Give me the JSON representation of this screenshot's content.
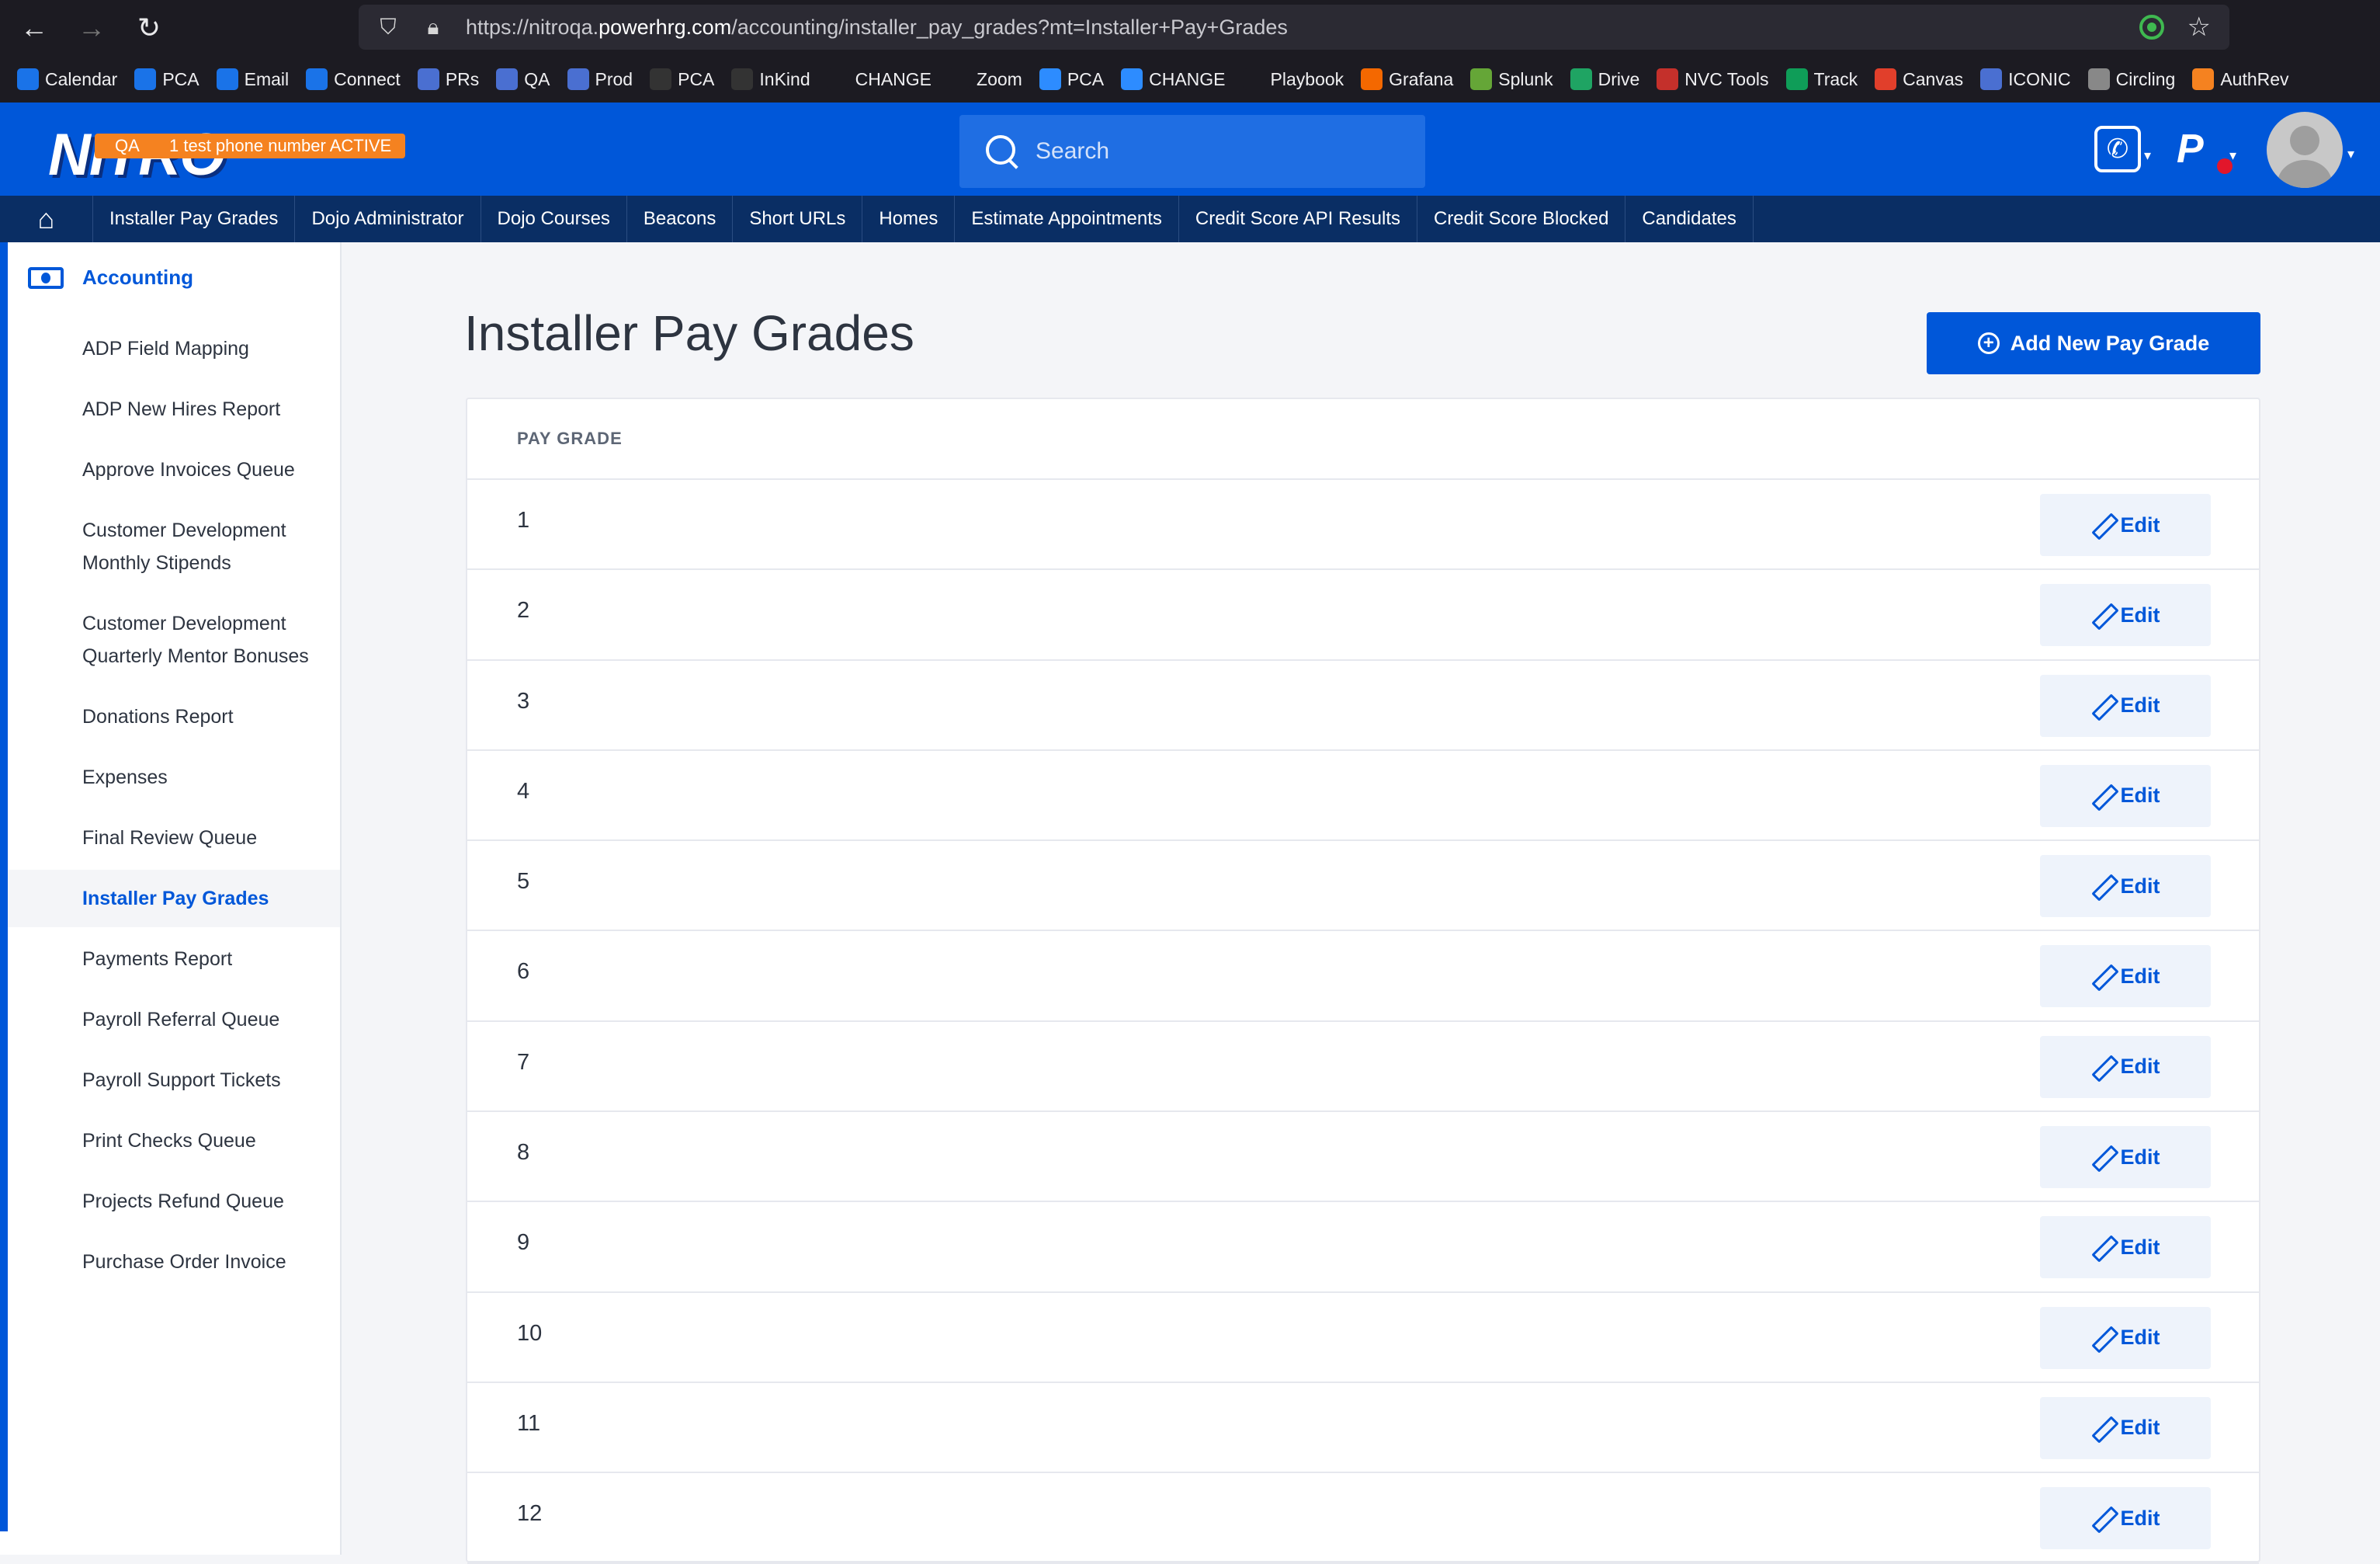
{
  "browser": {
    "url_prefix": "https://nitroqa.",
    "url_domain": "powerhrg.com",
    "url_path": "/accounting/installer_pay_grades?mt=Installer+Pay+Grades"
  },
  "bookmarks": [
    {
      "label": "Calendar",
      "icon": "calendar-icon",
      "color": "#1a73e8"
    },
    {
      "label": "PCA",
      "icon": "pca-icon",
      "color": "#1a73e8"
    },
    {
      "label": "Email",
      "icon": "email-icon",
      "color": "#1a73e8"
    },
    {
      "label": "Connect",
      "icon": "connect-icon",
      "color": "#1a73e8"
    },
    {
      "label": "PRs",
      "icon": "prs-icon",
      "color": "#4a6fd1"
    },
    {
      "label": "QA",
      "icon": "qa-icon",
      "color": "#4a6fd1"
    },
    {
      "label": "Prod",
      "icon": "prod-icon",
      "color": "#4a6fd1"
    },
    {
      "label": "PCA",
      "icon": "github-icon",
      "color": "#333333"
    },
    {
      "label": "InKind",
      "icon": "github-icon",
      "color": "#333333"
    },
    {
      "label": "CHANGE",
      "icon": "folder-icon",
      "color": "#1c1b22"
    },
    {
      "label": "Zoom",
      "icon": "folder-icon",
      "color": "#1c1b22"
    },
    {
      "label": "PCA",
      "icon": "zoom-icon",
      "color": "#2d8cff"
    },
    {
      "label": "CHANGE",
      "icon": "zoom-icon",
      "color": "#2d8cff"
    },
    {
      "label": "Playbook",
      "icon": "globe-icon",
      "color": "#1c1b22"
    },
    {
      "label": "Grafana",
      "icon": "grafana-icon",
      "color": "#f46800"
    },
    {
      "label": "Splunk",
      "icon": "splunk-icon",
      "color": "#65a637"
    },
    {
      "label": "Drive",
      "icon": "drive-icon",
      "color": "#1fa463"
    },
    {
      "label": "NVC Tools",
      "icon": "tools-icon",
      "color": "#c4302b"
    },
    {
      "label": "Track",
      "icon": "track-icon",
      "color": "#0f9d58"
    },
    {
      "label": "Canvas",
      "icon": "canvas-icon",
      "color": "#e13f2b"
    },
    {
      "label": "ICONIC",
      "icon": "iconic-icon",
      "color": "#4a6fd1"
    },
    {
      "label": "Circling",
      "icon": "circling-icon",
      "color": "#888888"
    },
    {
      "label": "AuthRev",
      "icon": "authrev-icon",
      "color": "#f58220"
    }
  ],
  "header": {
    "logo": "NITRO",
    "env_badge": "QA",
    "notice_badge": "1 test phone number ACTIVE",
    "search_placeholder": "Search"
  },
  "top_nav": [
    "Installer Pay Grades",
    "Dojo Administrator",
    "Dojo Courses",
    "Beacons",
    "Short URLs",
    "Homes",
    "Estimate Appointments",
    "Credit Score API Results",
    "Credit Score Blocked",
    "Candidates"
  ],
  "sidebar": {
    "title": "Accounting",
    "items": [
      {
        "label": "ADP Field Mapping",
        "active": false
      },
      {
        "label": "ADP New Hires Report",
        "active": false
      },
      {
        "label": "Approve Invoices Queue",
        "active": false
      },
      {
        "label": "Customer Development Monthly Stipends",
        "active": false
      },
      {
        "label": "Customer Development Quarterly Mentor Bonuses",
        "active": false
      },
      {
        "label": "Donations Report",
        "active": false
      },
      {
        "label": "Expenses",
        "active": false
      },
      {
        "label": "Final Review Queue",
        "active": false
      },
      {
        "label": "Installer Pay Grades",
        "active": true
      },
      {
        "label": "Payments Report",
        "active": false
      },
      {
        "label": "Payroll Referral Queue",
        "active": false
      },
      {
        "label": "Payroll Support Tickets",
        "active": false
      },
      {
        "label": "Print Checks Queue",
        "active": false
      },
      {
        "label": "Projects Refund Queue",
        "active": false
      },
      {
        "label": "Purchase Order Invoice",
        "active": false
      }
    ]
  },
  "main": {
    "title": "Installer Pay Grades",
    "add_button": "Add New Pay Grade",
    "column_header": "PAY GRADE",
    "edit_label": "Edit",
    "rows": [
      "1",
      "2",
      "3",
      "4",
      "5",
      "6",
      "7",
      "8",
      "9",
      "10",
      "11",
      "12"
    ]
  },
  "colors": {
    "brand_blue": "#0057d9",
    "nav_dark": "#0a2e64",
    "badge_orange": "#f58220"
  }
}
